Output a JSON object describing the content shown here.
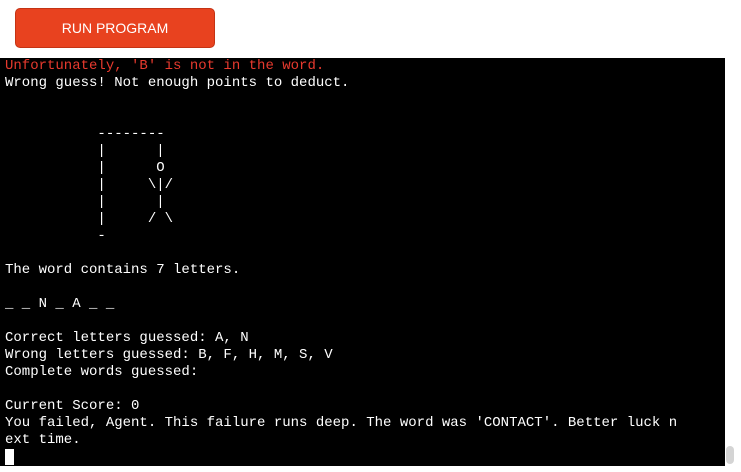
{
  "toolbar": {
    "run_label": "RUN PROGRAM"
  },
  "colors": {
    "run_button": "#e8421f",
    "terminal_bg": "#000000",
    "terminal_text": "#ffffff",
    "error_text": "#e83a2e"
  },
  "terminal": {
    "lines": [
      {
        "text": "Unfortunately, 'B' is not in the word.",
        "style": "error"
      },
      {
        "text": "Wrong guess! Not enough points to deduct.",
        "style": "normal"
      },
      {
        "text": "",
        "style": "normal"
      },
      {
        "text": "",
        "style": "normal"
      },
      {
        "text": "           --------",
        "style": "normal"
      },
      {
        "text": "           |      |",
        "style": "normal"
      },
      {
        "text": "           |      O",
        "style": "normal"
      },
      {
        "text": "           |     \\|/",
        "style": "normal"
      },
      {
        "text": "           |      |",
        "style": "normal"
      },
      {
        "text": "           |     / \\",
        "style": "normal"
      },
      {
        "text": "           -",
        "style": "normal"
      },
      {
        "text": "",
        "style": "normal"
      },
      {
        "text": "The word contains 7 letters.",
        "style": "normal"
      },
      {
        "text": "",
        "style": "normal"
      },
      {
        "text": "_ _ N _ A _ _",
        "style": "normal"
      },
      {
        "text": "",
        "style": "normal"
      },
      {
        "text": "Correct letters guessed: A, N",
        "style": "normal"
      },
      {
        "text": "Wrong letters guessed: B, F, H, M, S, V",
        "style": "normal"
      },
      {
        "text": "Complete words guessed:",
        "style": "normal"
      },
      {
        "text": "",
        "style": "normal"
      },
      {
        "text": "Current Score: 0",
        "style": "normal"
      },
      {
        "text": "You failed, Agent. This failure runs deep. The word was 'CONTACT'. Better luck n",
        "style": "normal"
      },
      {
        "text": "ext time.",
        "style": "normal"
      }
    ]
  }
}
